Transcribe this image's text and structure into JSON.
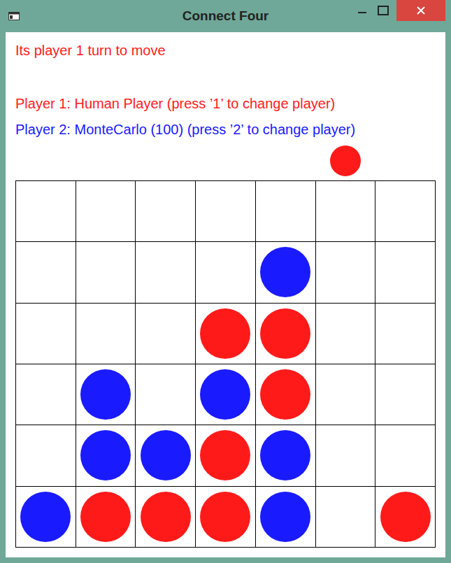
{
  "window": {
    "title": "Connect Four"
  },
  "status": {
    "text": "Its player 1 turn to move",
    "color": "#ff1a1a"
  },
  "players": [
    {
      "text": "Player 1: Human Player (press ’1’ to change player)",
      "color": "#ff1a1a"
    },
    {
      "text": "Player 2: MonteCarlo (100) (press ’2’ to change player)",
      "color": "#1a1aff"
    }
  ],
  "drop_columns": [
    {
      "selected": false,
      "color": "#ff1a1a"
    },
    {
      "selected": false,
      "color": "#ff1a1a"
    },
    {
      "selected": false,
      "color": "#ff1a1a"
    },
    {
      "selected": false,
      "color": "#ff1a1a"
    },
    {
      "selected": false,
      "color": "#ff1a1a"
    },
    {
      "selected": true,
      "color": "#ff1a1a"
    },
    {
      "selected": false,
      "color": "#ff1a1a"
    }
  ],
  "board": {
    "rows": [
      [
        {
          "filled": false,
          "color": "#ffffff"
        },
        {
          "filled": false,
          "color": "#ffffff"
        },
        {
          "filled": false,
          "color": "#ffffff"
        },
        {
          "filled": false,
          "color": "#ffffff"
        },
        {
          "filled": false,
          "color": "#ffffff"
        },
        {
          "filled": false,
          "color": "#ffffff"
        },
        {
          "filled": false,
          "color": "#ffffff"
        }
      ],
      [
        {
          "filled": false,
          "color": "#ffffff"
        },
        {
          "filled": false,
          "color": "#ffffff"
        },
        {
          "filled": false,
          "color": "#ffffff"
        },
        {
          "filled": false,
          "color": "#ffffff"
        },
        {
          "filled": true,
          "color": "#1a1aff"
        },
        {
          "filled": false,
          "color": "#ffffff"
        },
        {
          "filled": false,
          "color": "#ffffff"
        }
      ],
      [
        {
          "filled": false,
          "color": "#ffffff"
        },
        {
          "filled": false,
          "color": "#ffffff"
        },
        {
          "filled": false,
          "color": "#ffffff"
        },
        {
          "filled": true,
          "color": "#ff1a1a"
        },
        {
          "filled": true,
          "color": "#ff1a1a"
        },
        {
          "filled": false,
          "color": "#ffffff"
        },
        {
          "filled": false,
          "color": "#ffffff"
        }
      ],
      [
        {
          "filled": false,
          "color": "#ffffff"
        },
        {
          "filled": true,
          "color": "#1a1aff"
        },
        {
          "filled": false,
          "color": "#ffffff"
        },
        {
          "filled": true,
          "color": "#1a1aff"
        },
        {
          "filled": true,
          "color": "#ff1a1a"
        },
        {
          "filled": false,
          "color": "#ffffff"
        },
        {
          "filled": false,
          "color": "#ffffff"
        }
      ],
      [
        {
          "filled": false,
          "color": "#ffffff"
        },
        {
          "filled": true,
          "color": "#1a1aff"
        },
        {
          "filled": true,
          "color": "#1a1aff"
        },
        {
          "filled": true,
          "color": "#ff1a1a"
        },
        {
          "filled": true,
          "color": "#1a1aff"
        },
        {
          "filled": false,
          "color": "#ffffff"
        },
        {
          "filled": false,
          "color": "#ffffff"
        }
      ],
      [
        {
          "filled": true,
          "color": "#1a1aff"
        },
        {
          "filled": true,
          "color": "#ff1a1a"
        },
        {
          "filled": true,
          "color": "#ff1a1a"
        },
        {
          "filled": true,
          "color": "#ff1a1a"
        },
        {
          "filled": true,
          "color": "#1a1aff"
        },
        {
          "filled": false,
          "color": "#ffffff"
        },
        {
          "filled": true,
          "color": "#ff1a1a"
        }
      ]
    ]
  }
}
